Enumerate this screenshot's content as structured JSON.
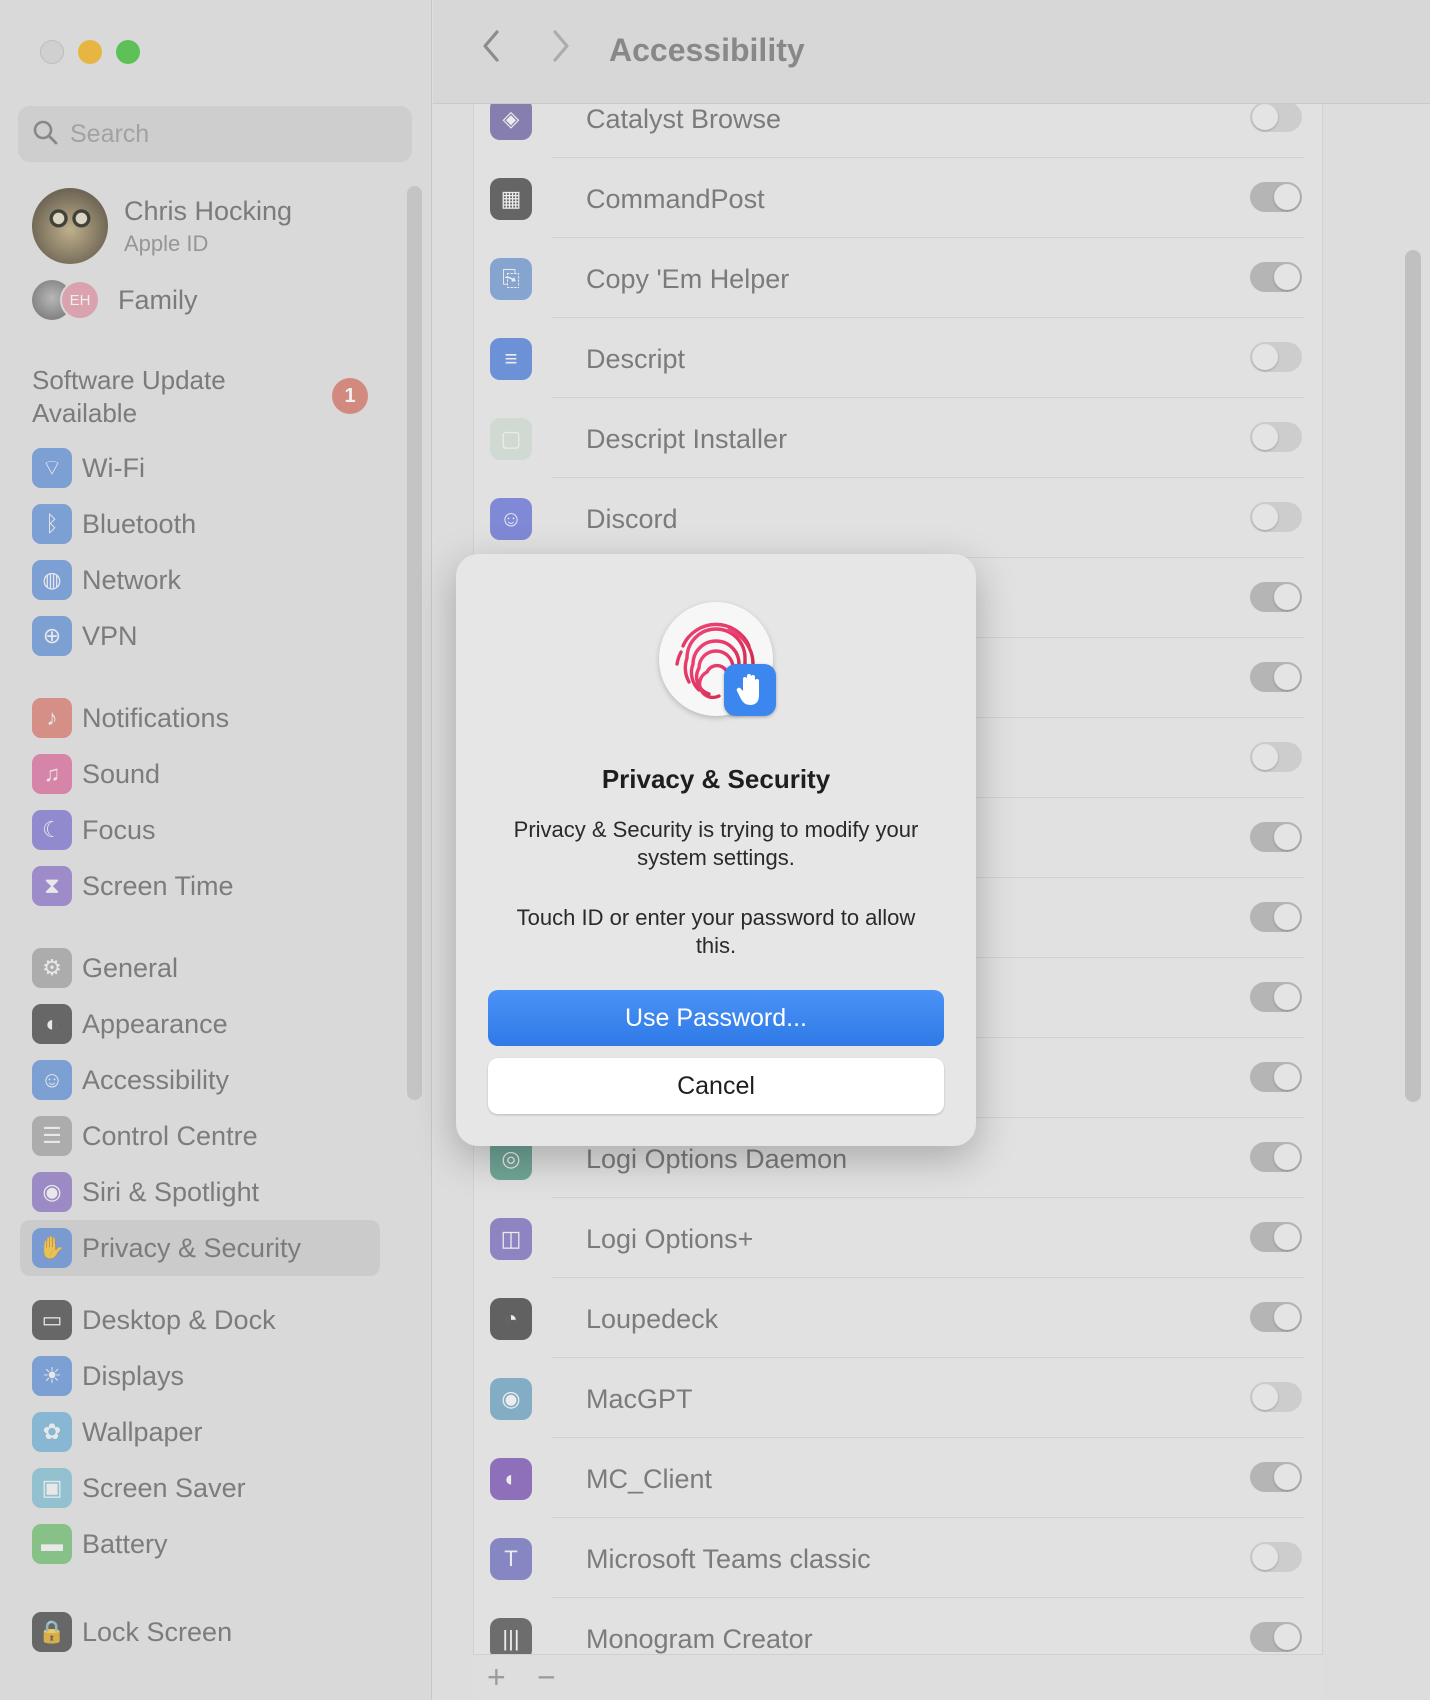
{
  "window": {
    "toolbar": {
      "title": "Accessibility",
      "back_icon": "chevron-left",
      "forward_icon": "chevron-right"
    }
  },
  "sidebar": {
    "search_placeholder": "Search",
    "profile": {
      "name": "Chris Hocking",
      "subtitle": "Apple ID"
    },
    "family": {
      "label": "Family",
      "initials": "EH"
    },
    "software_update": {
      "label": "Software Update Available",
      "badge": "1"
    },
    "groups": [
      [
        {
          "label": "Wi-Fi",
          "icon": "wifi",
          "color": "#5b8fe0"
        },
        {
          "label": "Bluetooth",
          "icon": "bluetooth",
          "color": "#5b8fe0"
        },
        {
          "label": "Network",
          "icon": "globe",
          "color": "#5b8fe0"
        },
        {
          "label": "VPN",
          "icon": "globe-network",
          "color": "#5b8fe0"
        }
      ],
      [
        {
          "label": "Notifications",
          "icon": "bell",
          "color": "#e3766a"
        },
        {
          "label": "Sound",
          "icon": "speaker",
          "color": "#e3669a"
        },
        {
          "label": "Focus",
          "icon": "moon",
          "color": "#7b6fd6"
        },
        {
          "label": "Screen Time",
          "icon": "hourglass",
          "color": "#8c72cf"
        }
      ],
      [
        {
          "label": "General",
          "icon": "gear",
          "color": "#a3a3a3"
        },
        {
          "label": "Appearance",
          "icon": "appearance",
          "color": "#3a3a3a"
        },
        {
          "label": "Accessibility",
          "icon": "accessibility",
          "color": "#5b8fe0"
        },
        {
          "label": "Control Centre",
          "icon": "toggles",
          "color": "#a3a3a3"
        },
        {
          "label": "Siri & Spotlight",
          "icon": "siri",
          "color": "#8a6fc9"
        },
        {
          "label": "Privacy & Security",
          "icon": "hand",
          "color": "#5b8fe0",
          "active": true
        }
      ],
      [
        {
          "label": "Desktop & Dock",
          "icon": "dock",
          "color": "#3a3a3a"
        },
        {
          "label": "Displays",
          "icon": "sun",
          "color": "#5b8fe0"
        },
        {
          "label": "Wallpaper",
          "icon": "flower",
          "color": "#6cb4e0"
        },
        {
          "label": "Screen Saver",
          "icon": "screensaver",
          "color": "#7ec3d8"
        },
        {
          "label": "Battery",
          "icon": "battery",
          "color": "#6cc36c"
        }
      ],
      [
        {
          "label": "Lock Screen",
          "icon": "lock",
          "color": "#3a3a3a"
        }
      ]
    ]
  },
  "apps": [
    {
      "label": "Catalyst Browse",
      "icon": "catalyst",
      "color": "#6f63a8",
      "enabled": false
    },
    {
      "label": "CommandPost",
      "icon": "commandpost",
      "color": "#3f3f3f",
      "enabled": true
    },
    {
      "label": "Copy 'Em Helper",
      "icon": "copy-em",
      "color": "#6d9ad8",
      "enabled": true
    },
    {
      "label": "Descript",
      "icon": "descript",
      "color": "#4a7fe0",
      "enabled": false
    },
    {
      "label": "Descript Installer",
      "icon": "installer",
      "color": "#d8e4da",
      "enabled": false
    },
    {
      "label": "Discord",
      "icon": "discord",
      "color": "#6673e0",
      "enabled": false
    },
    {
      "label": "",
      "icon": "",
      "color": "",
      "enabled": true
    },
    {
      "label": "",
      "icon": "",
      "color": "",
      "enabled": true
    },
    {
      "label": "",
      "icon": "",
      "color": "",
      "enabled": false
    },
    {
      "label": "",
      "icon": "",
      "color": "",
      "enabled": true
    },
    {
      "label": "",
      "icon": "",
      "color": "",
      "enabled": true
    },
    {
      "label": "",
      "icon": "",
      "color": "",
      "enabled": true
    },
    {
      "label": "",
      "icon": "",
      "color": "",
      "enabled": true
    },
    {
      "label": "Logi Options Daemon",
      "icon": "logi-daemon",
      "color": "#4f9a86",
      "enabled": true
    },
    {
      "label": "Logi Options+",
      "icon": "logi-options",
      "color": "#7a6cc4",
      "enabled": true
    },
    {
      "label": "Loupedeck",
      "icon": "loupedeck",
      "color": "#3a3a3a",
      "enabled": true
    },
    {
      "label": "MacGPT",
      "icon": "macgpt",
      "color": "#6ba6c8",
      "enabled": false
    },
    {
      "label": "MC_Client",
      "icon": "mc-client",
      "color": "#7a4fb8",
      "enabled": true
    },
    {
      "label": "Microsoft Teams classic",
      "icon": "teams",
      "color": "#6d6fc4",
      "enabled": false
    },
    {
      "label": "Monogram Creator",
      "icon": "monogram",
      "color": "#4a4a4a",
      "enabled": true
    }
  ],
  "list_footer": {
    "add": "+",
    "remove": "−"
  },
  "dialog": {
    "title": "Privacy & Security",
    "message": "Privacy & Security is trying to modify your system settings.",
    "prompt": "Touch ID or enter your password to allow this.",
    "primary_button": "Use Password...",
    "cancel_button": "Cancel",
    "icon": "touch-id-fingerprint",
    "badge_icon": "hand",
    "accent": "#3b86ef"
  }
}
